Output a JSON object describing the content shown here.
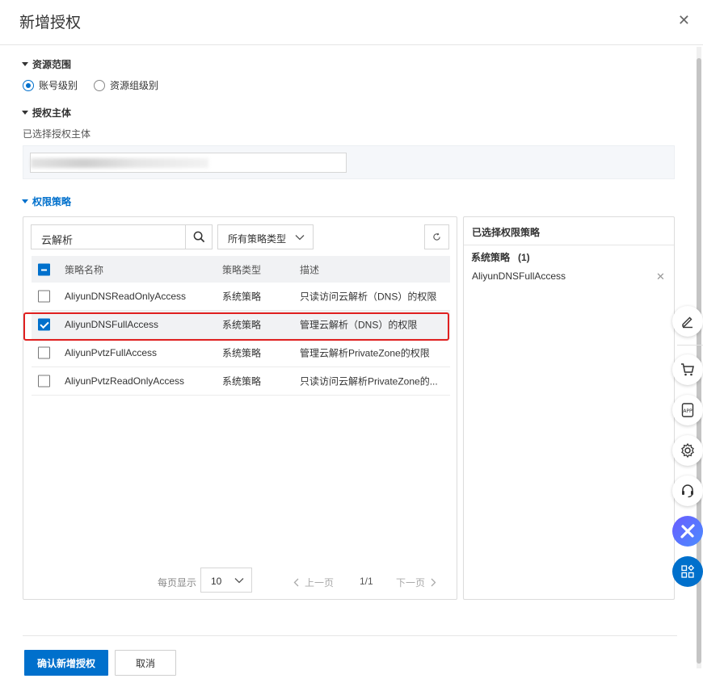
{
  "dialog": {
    "title": "新增授权"
  },
  "scope": {
    "heading": "资源范围",
    "options": [
      "账号级别",
      "资源组级别"
    ],
    "selected": "账号级别"
  },
  "principal": {
    "heading": "授权主体",
    "label": "已选择授权主体"
  },
  "policy": {
    "heading": "权限策略",
    "search_value": "云解析",
    "type_filter": "所有策略类型",
    "columns": {
      "name": "策略名称",
      "type": "策略类型",
      "desc": "描述"
    },
    "rows": [
      {
        "name": "AliyunDNSReadOnlyAccess",
        "type": "系统策略",
        "desc": "只读访问云解析（DNS）的权限",
        "checked": false
      },
      {
        "name": "AliyunDNSFullAccess",
        "type": "系统策略",
        "desc": "管理云解析（DNS）的权限",
        "checked": true
      },
      {
        "name": "AliyunPvtzFullAccess",
        "type": "系统策略",
        "desc": "管理云解析PrivateZone的权限",
        "checked": false
      },
      {
        "name": "AliyunPvtzReadOnlyAccess",
        "type": "系统策略",
        "desc": "只读访问云解析PrivateZone的...",
        "checked": false
      }
    ],
    "pager": {
      "per_page_label": "每页显示",
      "per_page": "10",
      "prev": "上一页",
      "page": "1/1",
      "next": "下一页"
    }
  },
  "selected_panel": {
    "title": "已选择权限策略",
    "group": "系统策略",
    "count": "(1)",
    "items": [
      "AliyunDNSFullAccess"
    ]
  },
  "footer": {
    "confirm": "确认新增授权",
    "cancel": "取消"
  },
  "colors": {
    "primary": "#0070cc",
    "highlight": "#e02020"
  }
}
